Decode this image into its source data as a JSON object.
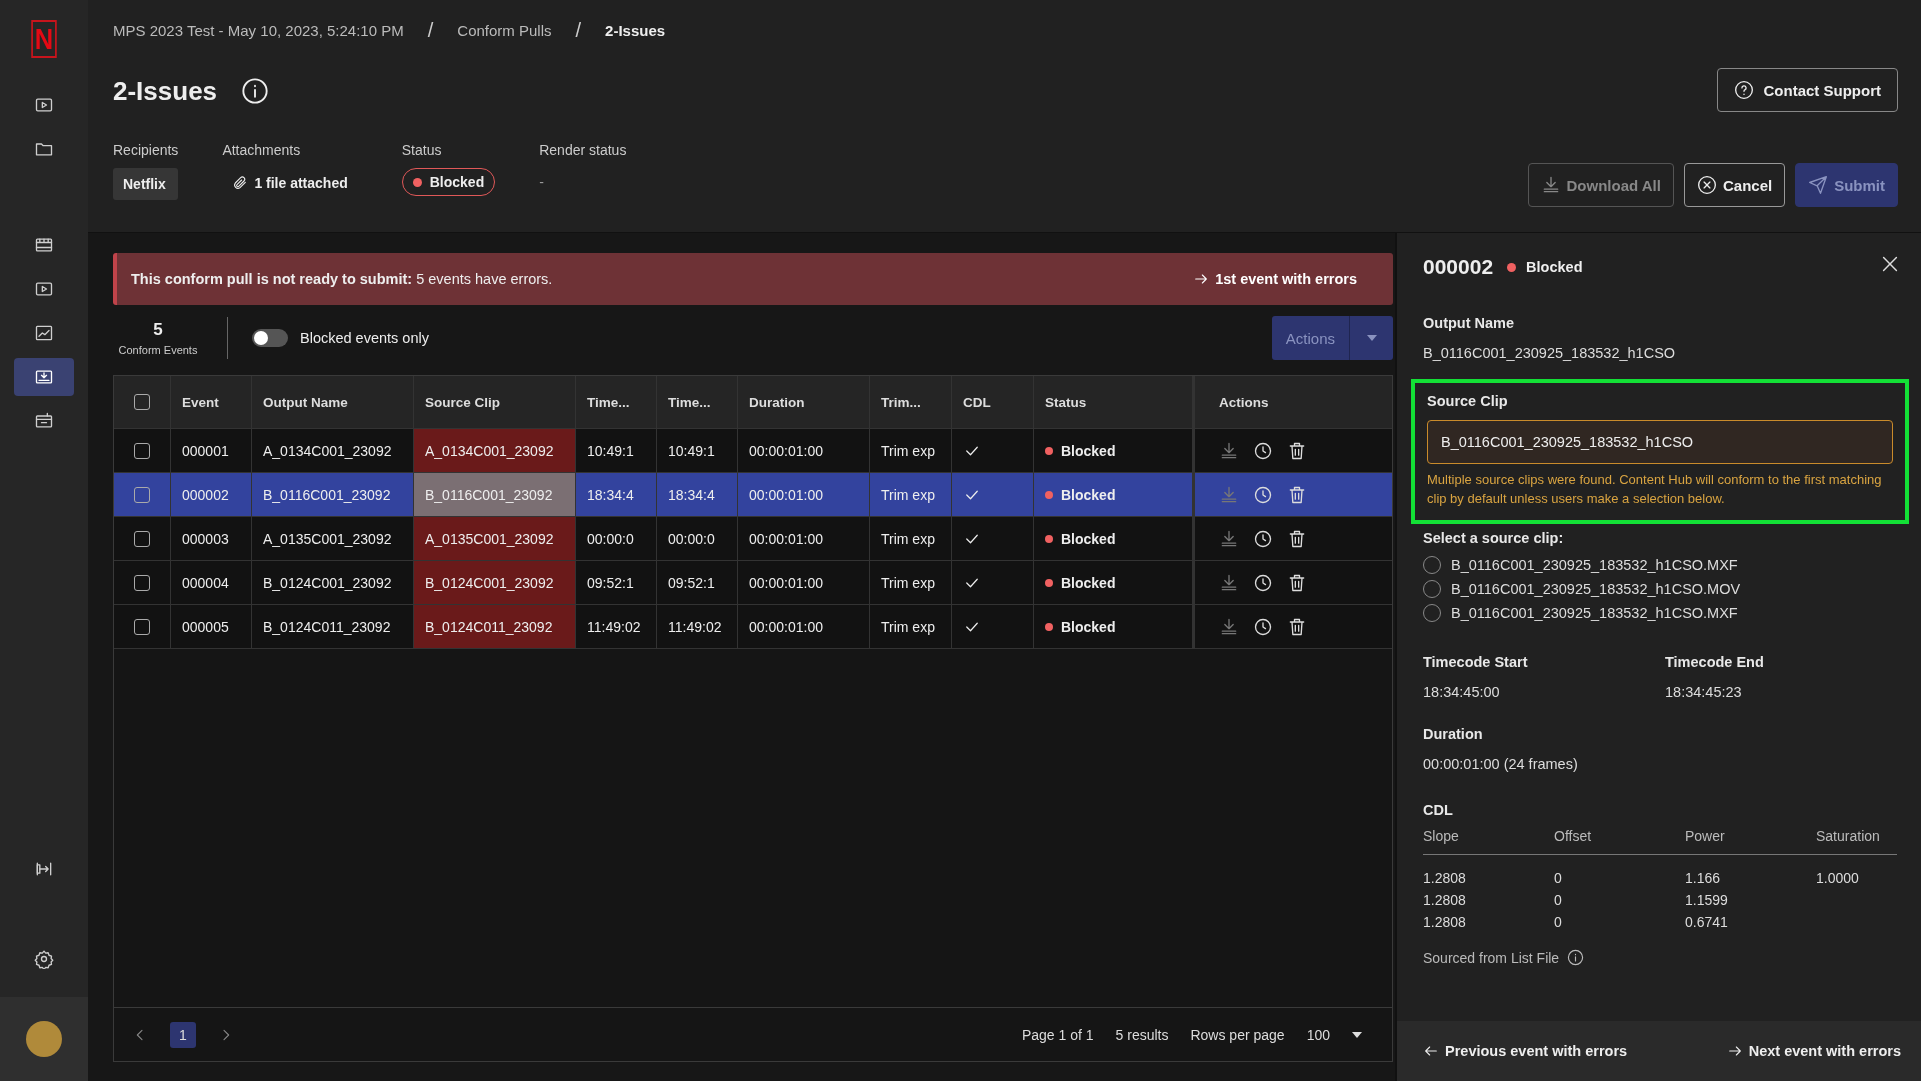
{
  "sidebar": {
    "logo": "N",
    "items": [
      {
        "selected": false
      },
      {
        "selected": false
      },
      {
        "selected": false
      },
      {
        "selected": false
      },
      {
        "selected": false
      },
      {
        "selected": true
      },
      {
        "selected": false
      }
    ]
  },
  "breadcrumb": [
    "MPS 2023 Test - May 10, 2023, 5:24:10 PM",
    "/",
    "Conform Pulls",
    "/",
    "2-Issues"
  ],
  "title": "2-Issues",
  "meta": [
    {
      "kind": "chip",
      "label": "Recipients",
      "value": "Netflix"
    },
    {
      "kind": "attachment",
      "label": "Attachments",
      "value": "1 file attached"
    },
    {
      "kind": "status",
      "label": "Status",
      "value": "Blocked"
    },
    {
      "kind": "plain",
      "label": "Render status",
      "value": "-"
    }
  ],
  "contact_button": {
    "label": "Contact Support"
  },
  "action_buttons": [
    {
      "kind": "download",
      "label": "Download All",
      "disabled": true
    },
    {
      "kind": "cancel",
      "label": "Cancel",
      "disabled": false
    },
    {
      "kind": "submit",
      "label": "Submit",
      "disabled": true
    }
  ],
  "banner": {
    "message": "**This conform pull is not ready to submit:** 5 events have errors.",
    "link": "1st event with errors"
  },
  "summary": {
    "count": "5",
    "label": "Conform Events"
  },
  "toggle": {
    "label": "Blocked events only",
    "on": false
  },
  "actions_menu": {
    "label": "Actions",
    "disabled": true
  },
  "table": {
    "select_all": false,
    "columns": [
      "Event",
      "Output Name",
      "Source Clip",
      "Time...",
      "Time...",
      "Duration",
      "Trim...",
      "CDL",
      "Status",
      "Actions"
    ],
    "rows": [
      {
        "event": "000001",
        "output": "A_0134C001_23092",
        "source": "A_0134C001_23092",
        "source_error": true,
        "time_in": "10:49:1",
        "time_out": "10:49:1",
        "duration": "00:00:01:00",
        "trim": "Trim exp",
        "cdl": true,
        "status": "Blocked",
        "checked": false,
        "selected": false
      },
      {
        "event": "000002",
        "output": "B_0116C001_23092",
        "source": "B_0116C001_23092",
        "source_error": true,
        "time_in": "18:34:4",
        "time_out": "18:34:4",
        "duration": "00:00:01:00",
        "trim": "Trim exp",
        "cdl": true,
        "status": "Blocked",
        "checked": false,
        "selected": true
      },
      {
        "event": "000003",
        "output": "A_0135C001_23092",
        "source": "A_0135C001_23092",
        "source_error": true,
        "time_in": "00:00:0",
        "time_out": "00:00:0",
        "duration": "00:00:01:00",
        "trim": "Trim exp",
        "cdl": true,
        "status": "Blocked",
        "checked": false,
        "selected": false
      },
      {
        "event": "000004",
        "output": "B_0124C001_23092",
        "source": "B_0124C001_23092",
        "source_error": true,
        "time_in": "09:52:1",
        "time_out": "09:52:1",
        "duration": "00:00:01:00",
        "trim": "Trim exp",
        "cdl": true,
        "status": "Blocked",
        "checked": false,
        "selected": false
      },
      {
        "event": "000005",
        "output": "B_0124C011_23092",
        "source": "B_0124C011_23092",
        "source_error": true,
        "time_in": "11:49:02",
        "time_out": "11:49:02",
        "duration": "00:00:01:00",
        "trim": "Trim exp",
        "cdl": true,
        "status": "Blocked",
        "checked": false,
        "selected": false
      }
    ]
  },
  "pagination": {
    "pages": [
      {
        "label": "1",
        "selected": true
      }
    ],
    "page_info": "Page 1 of 1",
    "results": "5 results",
    "rows_label": "Rows per page",
    "rows_value": "100"
  },
  "panel": {
    "event": "000002",
    "status": "Blocked",
    "output_label": "Output Name",
    "output_value": "B_0116C001_230925_183532_h1CSO",
    "source_clip": {
      "label": "Source Clip",
      "value": "B_0116C001_230925_183532_h1CSO",
      "warning": "Multiple source clips were found. Content Hub will conform to the first matching clip by default unless users make a selection below.",
      "highlighted": true
    },
    "select_label": "Select a source clip:",
    "options": [
      {
        "label": "B_0116C001_230925_183532_h1CSO.MXF",
        "selected": false
      },
      {
        "label": "B_0116C001_230925_183532_h1CSO.MOV",
        "selected": false
      },
      {
        "label": "B_0116C001_230925_183532_h1CSO.MXF",
        "selected": false
      }
    ],
    "timecodes": [
      {
        "label": "Timecode Start",
        "value": "18:34:45:00"
      },
      {
        "label": "Timecode End",
        "value": "18:34:45:23"
      }
    ],
    "duration_label": "Duration",
    "duration_value": "00:00:01:00 (24 frames)",
    "cdl_label": "CDL",
    "cdl_columns": [
      "Slope",
      "Offset",
      "Power",
      "Saturation"
    ],
    "cdl_rows": [
      [
        "1.2808",
        "0",
        "1.166",
        "1.0000"
      ],
      [
        "1.2808",
        "0",
        "1.1599",
        ""
      ],
      [
        "1.2808",
        "0",
        "0.6741",
        ""
      ]
    ],
    "source_note": "Sourced from List File",
    "prev": "Previous event with errors",
    "next": "Next event with errors"
  }
}
